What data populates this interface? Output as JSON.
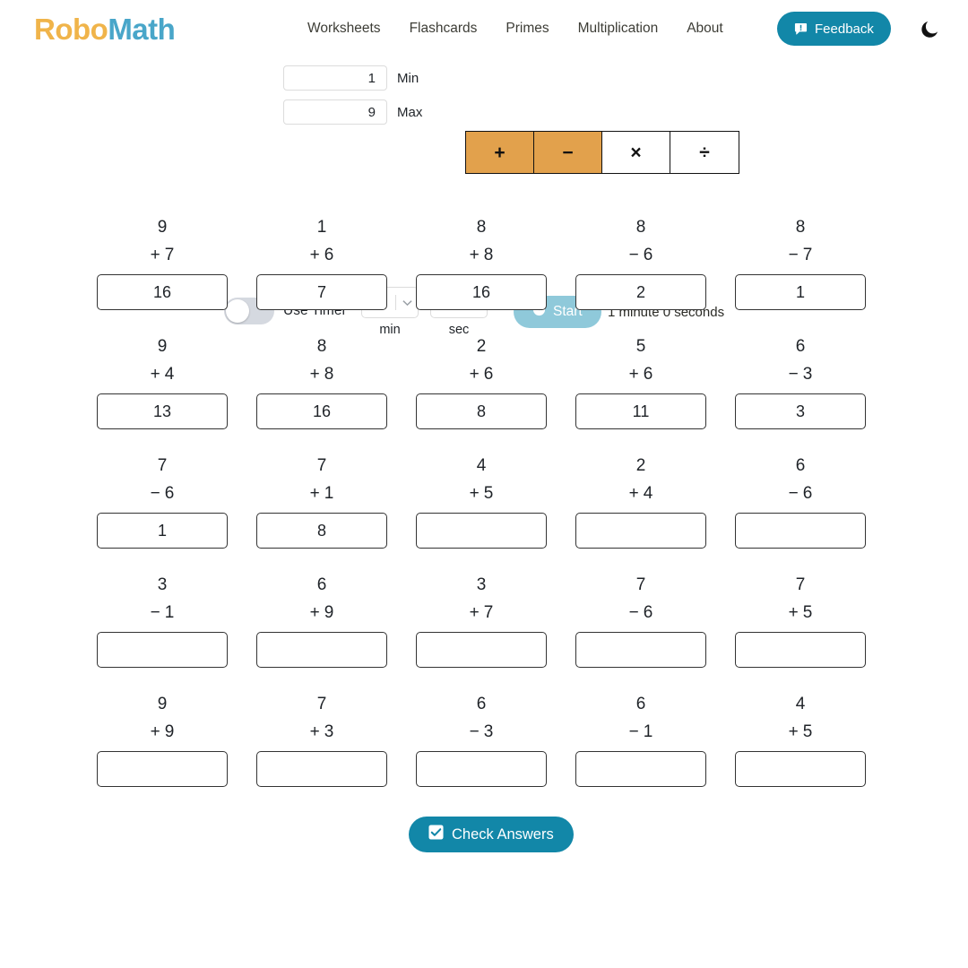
{
  "header": {
    "logo_part1": "Robo",
    "logo_part2": "Math",
    "nav": [
      {
        "label": "Worksheets"
      },
      {
        "label": "Flashcards"
      },
      {
        "label": "Primes"
      },
      {
        "label": "Multiplication"
      },
      {
        "label": "About"
      }
    ],
    "feedback_label": "Feedback",
    "feedback_icon": "comment-alert-icon",
    "theme_icon": "moon-icon",
    "accent_color": "#1287a8",
    "logo_color_1": "#f0b44a",
    "logo_color_2": "#49a6c9"
  },
  "controls": {
    "min_value": "1",
    "min_label": "Min",
    "max_value": "9",
    "max_label": "Max",
    "operators": [
      {
        "symbol": "+",
        "name": "plus",
        "active": true
      },
      {
        "symbol": "−",
        "name": "minus",
        "active": true
      },
      {
        "symbol": "×",
        "name": "multiply",
        "active": false
      },
      {
        "symbol": "÷",
        "name": "divide",
        "active": false
      }
    ],
    "active_color": "#e2a14c",
    "inactive_color": "#ffffff"
  },
  "timer": {
    "toggle_label": "Use Timer",
    "toggle_on": false,
    "minutes_value": "1",
    "minutes_unit": "min",
    "seconds_value": "0",
    "seconds_unit": "sec",
    "start_label": "Start",
    "start_icon": "clock-icon",
    "start_disabled": true,
    "countdown_text": "1 minute 0 seconds"
  },
  "worksheet": {
    "rows": [
      [
        {
          "top": "9",
          "op": "+",
          "bottom": "7",
          "answer": "16"
        },
        {
          "top": "1",
          "op": "+",
          "bottom": "6",
          "answer": "7"
        },
        {
          "top": "8",
          "op": "+",
          "bottom": "8",
          "answer": "16"
        },
        {
          "top": "8",
          "op": "−",
          "bottom": "6",
          "answer": "2"
        },
        {
          "top": "8",
          "op": "−",
          "bottom": "7",
          "answer": "1"
        }
      ],
      [
        {
          "top": "9",
          "op": "+",
          "bottom": "4",
          "answer": "13"
        },
        {
          "top": "8",
          "op": "+",
          "bottom": "8",
          "answer": "16"
        },
        {
          "top": "2",
          "op": "+",
          "bottom": "6",
          "answer": "8"
        },
        {
          "top": "5",
          "op": "+",
          "bottom": "6",
          "answer": "11"
        },
        {
          "top": "6",
          "op": "−",
          "bottom": "3",
          "answer": "3"
        }
      ],
      [
        {
          "top": "7",
          "op": "−",
          "bottom": "6",
          "answer": "1"
        },
        {
          "top": "7",
          "op": "+",
          "bottom": "1",
          "answer": "8"
        },
        {
          "top": "4",
          "op": "+",
          "bottom": "5",
          "answer": ""
        },
        {
          "top": "2",
          "op": "+",
          "bottom": "4",
          "answer": ""
        },
        {
          "top": "6",
          "op": "−",
          "bottom": "6",
          "answer": ""
        }
      ],
      [
        {
          "top": "3",
          "op": "−",
          "bottom": "1",
          "answer": ""
        },
        {
          "top": "6",
          "op": "+",
          "bottom": "9",
          "answer": ""
        },
        {
          "top": "3",
          "op": "+",
          "bottom": "7",
          "answer": ""
        },
        {
          "top": "7",
          "op": "−",
          "bottom": "6",
          "answer": ""
        },
        {
          "top": "7",
          "op": "+",
          "bottom": "5",
          "answer": ""
        }
      ],
      [
        {
          "top": "9",
          "op": "+",
          "bottom": "9",
          "answer": ""
        },
        {
          "top": "7",
          "op": "+",
          "bottom": "3",
          "answer": ""
        },
        {
          "top": "6",
          "op": "−",
          "bottom": "3",
          "answer": ""
        },
        {
          "top": "6",
          "op": "−",
          "bottom": "1",
          "answer": ""
        },
        {
          "top": "4",
          "op": "+",
          "bottom": "5",
          "answer": ""
        }
      ]
    ]
  },
  "footer": {
    "check_label": "Check Answers",
    "check_icon": "checkbox-checked-icon"
  }
}
